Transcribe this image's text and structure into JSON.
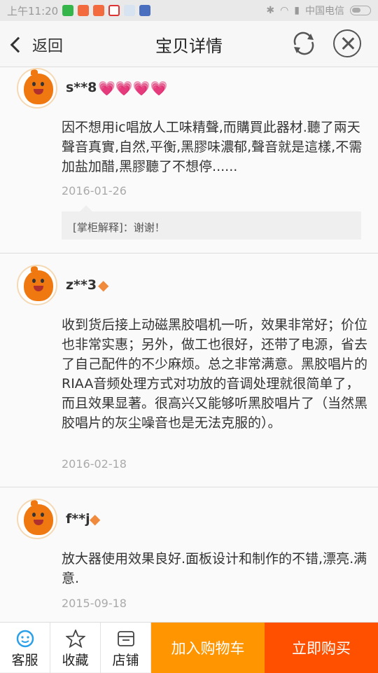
{
  "status": {
    "time": "上午11:20",
    "carrier": "中国电信"
  },
  "header": {
    "back_label": "返回",
    "title": "宝贝详情"
  },
  "reviews": [
    {
      "username": "s**8",
      "badge_icon": "heart-icon",
      "text": "因不想用ic唱放人工味精聲,而購買此器材.聽了兩天聲音真實,自然,平衡,黑膠味濃郁,聲音就是這樣,不需加盐加醋,黑膠聽了不想停......",
      "date": "2016-01-26",
      "reply": "[掌柜解释]：谢谢！"
    },
    {
      "username": "z**3",
      "badge_icon": "diamond-icon",
      "text": "收到货后接上动磁黑胶唱机一听，效果非常好；价位也非常实惠；另外，做工也很好，还带了电源，省去了自己配件的不少麻烦。总之非常满意。黑胶唱片的RIAA音频处理方式对功放的音调处理就很简单了，而且效果显著。很高兴又能够听黑胶唱片了（当然黑胶唱片的灰尘噪音也是无法克服的）。",
      "date": "2016-02-18"
    },
    {
      "username": "f**j",
      "badge_icon": "diamond-icon",
      "text": "放大器使用效果良好.面板设计和制作的不错,漂亮.满意.",
      "date": "2015-09-18"
    }
  ],
  "bottom": {
    "service_label": "客服",
    "favorite_label": "收藏",
    "store_label": "店铺",
    "add_cart_label": "加入购物车",
    "buy_label": "立即购买"
  },
  "colors": {
    "cart": "#ff9500",
    "buy": "#ff5000",
    "accent_icon": "#2aa0e8"
  }
}
